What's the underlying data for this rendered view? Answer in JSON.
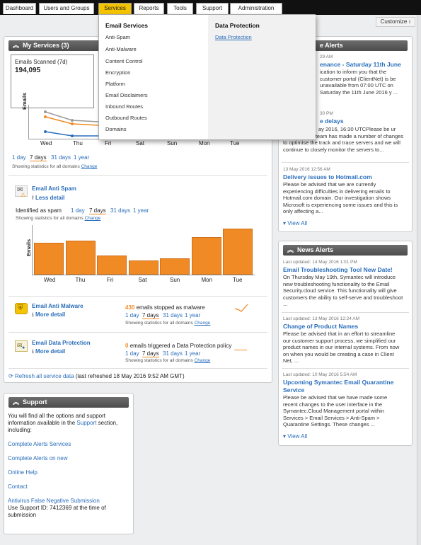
{
  "nav": {
    "tabs": [
      "Dashboard",
      "Users and Groups",
      "Services",
      "Reports",
      "Tools",
      "Support",
      "Administration"
    ],
    "active": "Services",
    "customize": "Customize"
  },
  "services_menu": {
    "email_heading": "Email Services",
    "email_items": [
      "Anti-Spam",
      "Anti-Malware",
      "Content Control",
      "Encryption",
      "Platform",
      "Email Disclaimers",
      "Inbound Routes",
      "Outbound Routes",
      "Domains"
    ],
    "dp_heading": "Data Protection",
    "dp_items": [
      "Data Protection"
    ]
  },
  "my_services": {
    "title": "My Services",
    "count": "(3)",
    "scanned_label": "Emails Scanned (7d)",
    "scanned_value": "194,095",
    "ylabel": "Emails",
    "days": [
      "Wed",
      "Thu",
      "Fri",
      "Sat",
      "Sun",
      "Mon",
      "Tue"
    ],
    "periods": [
      "1 day",
      "7 days",
      "31 days",
      "1 year"
    ],
    "showing": "Showing statistics for all domains",
    "change": "Change",
    "colors": {
      "gray": "#9a9a9a",
      "orange": "#f08a24",
      "blue": "#2a6ebb"
    }
  },
  "anti_spam": {
    "name": "Email Anti Spam",
    "less": "Less detail",
    "identified": "Identified as spam",
    "periods": [
      "1 day",
      "7 days",
      "31 days",
      "1 year"
    ],
    "showing": "Showing statistics for all domains",
    "change": "Change",
    "chart_data": {
      "type": "bar",
      "categories": [
        "Wed",
        "Thu",
        "Fri",
        "Sat",
        "Sun",
        "Mon",
        "Tue"
      ],
      "values": [
        0.62,
        0.66,
        0.38,
        0.28,
        0.32,
        0.74,
        0.9
      ],
      "ylabel": "Emails",
      "color": "#f08a24"
    }
  },
  "anti_malware": {
    "name": "Email Anti Malware",
    "more": "More detail",
    "count": "430",
    "stat_text": "emails stopped as malware",
    "periods": [
      "1 day",
      "7 days",
      "31 days",
      "1 year"
    ],
    "showing": "Showing statistics for all domains",
    "change": "Change"
  },
  "data_protection": {
    "name": "Email Data Protection",
    "more": "More detail",
    "count": "0",
    "stat_text": "emails triggered a Data Protection policy",
    "periods": [
      "1 day",
      "7 days",
      "31 days",
      "1 year"
    ],
    "showing": "Showing statistics for all domains",
    "change": "Change"
  },
  "refresh": {
    "link": "Refresh all service data",
    "text": "(last refreshed 18 May 2016 9:52 AM GMT)"
  },
  "support": {
    "title": "Support",
    "intro_pre": "You will find all the options and support information available in the",
    "intro_link": "Support",
    "intro_post": "section, including:",
    "links": [
      "Complete Alerts Services",
      "Complete Alerts on new",
      "Online Help",
      "Contact",
      "Antivirus False Negative Submission"
    ],
    "support_id": "Use Support ID: 7412369 at the time of submission"
  },
  "service_alerts": {
    "title_fragment": "e Alerts",
    "items": [
      {
        "time": "29 AM",
        "title_lines": [
          "enance - Saturday 11th June"
        ],
        "body": "ication to inform you that the customer portal (ClientNet) is be unavailable from 07:00 UTC on Saturday the 11th June 2016 y ..."
      },
      {
        "time": "30 PM",
        "title_lines": [
          "e delays"
        ],
        "body": "ay 2016, 16:30 UTCPlease be ur infrastructure team has made a number of changes to optimise the track and trace servers and we will continue to closely monitor the servers to..."
      },
      {
        "time": "13 May 2016 12:56 AM",
        "title_lines": [
          "Delivery issues to Hotmail.com"
        ],
        "body": "Please be advised that we are currently experiencing difficulties in delivering emails to Hotmail.com domain. Our investigation shows Microsoft is experiencing some issues and this is only affecting a..."
      }
    ],
    "view_all": "View All"
  },
  "news_alerts": {
    "title": "News Alerts",
    "items": [
      {
        "time": "Last updated: 14 May 2016 1:01 PM",
        "title_lines": [
          "Email Troubleshooting Tool New Date!"
        ],
        "body": "On Thursday May 19th, Symantec will introduce new troubleshooting functionality to the Email Security.cloud service. This functionality will give customers the ability to self-serve and troubleshoot ..."
      },
      {
        "time": "Last updated: 13 May 2016 12:24 AM",
        "title_lines": [
          "Change of Product Names"
        ],
        "body": "Please be advised that in an effort to streamline our customer support process, we simplified our product names in our internal systems. From now on when you would be creating a case in Client Net, ..."
      },
      {
        "time": "Last updated: 10 May 2016 5:54 AM",
        "title_lines": [
          "Upcoming Symantec Email Quarantine",
          "Service"
        ],
        "body": "Please be advised that we have made some recent changes to the user interface in the Symantec.Cloud Management portal within Services > Email Services > Anti-Spam > Quarantine Settings. These changes ..."
      }
    ],
    "view_all": "View All"
  }
}
